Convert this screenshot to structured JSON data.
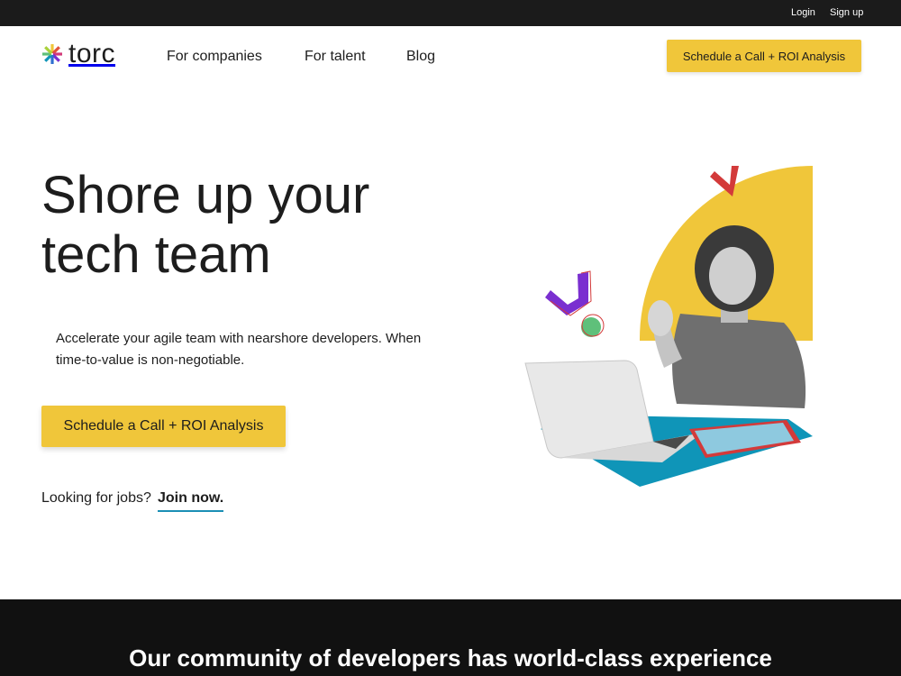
{
  "topbar": {
    "login": "Login",
    "signup": "Sign up"
  },
  "nav": {
    "logo_text": "torc",
    "links": [
      "For companies",
      "For talent",
      "Blog"
    ],
    "cta": "Schedule a Call + ROI Analysis"
  },
  "hero": {
    "title": "Shore up your tech team",
    "subtitle": "Accelerate your agile team with nearshore developers. When time-to-value is non-negotiable.",
    "cta": "Schedule a Call + ROI Analysis",
    "jobs_prompt": "Looking for jobs?",
    "jobs_link": "Join now."
  },
  "colors": {
    "accent": "#f0c63a",
    "dark": "#1b1b1b",
    "link_underline": "#1b8fb5",
    "teal": "#0f95b8",
    "purple": "#7a2fd0",
    "red": "#d33a3a",
    "green": "#5fc07a"
  },
  "icons": [
    "torc-logo-icon"
  ],
  "section": {
    "title": "Our community of developers has world-class experience"
  }
}
